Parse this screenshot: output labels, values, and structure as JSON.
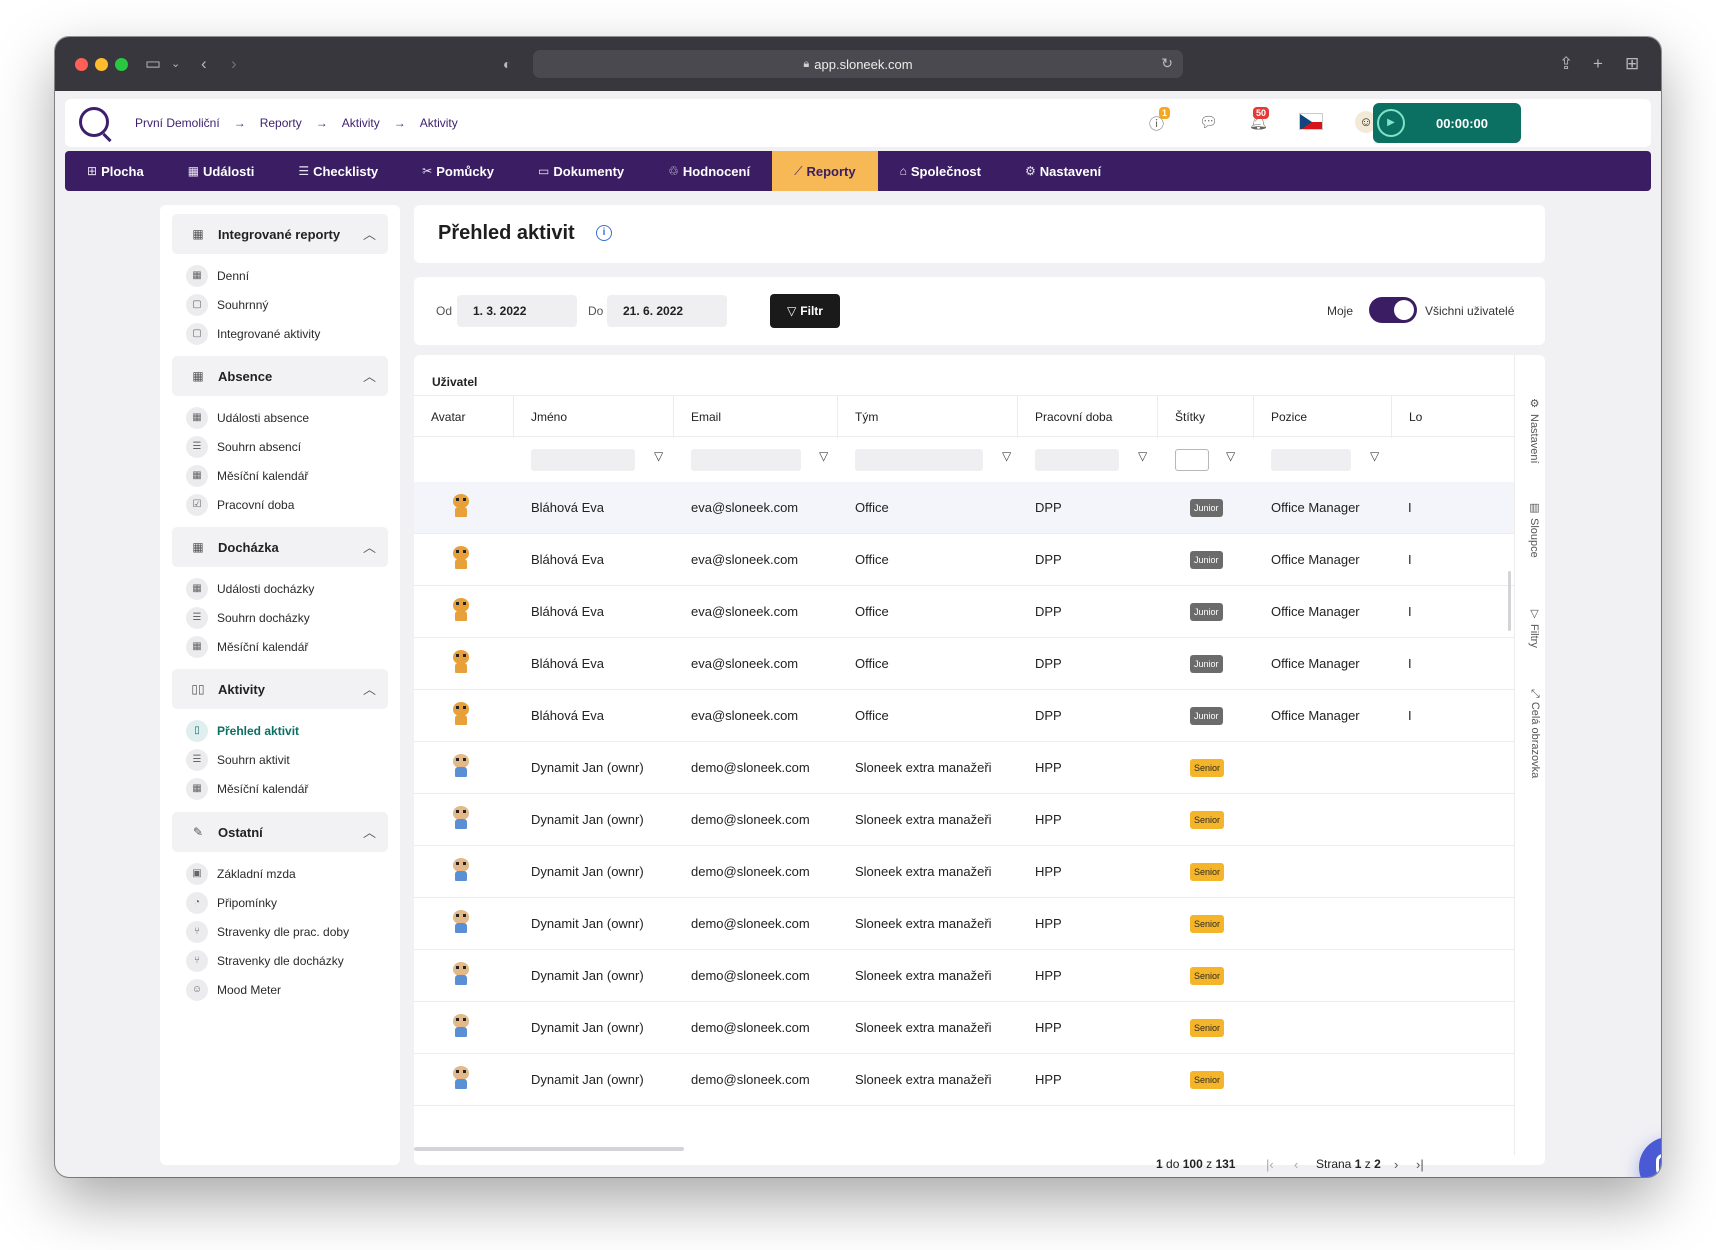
{
  "browser": {
    "url": "app.sloneek.com"
  },
  "breadcrumb": [
    "První Demoliční",
    "Reporty",
    "Aktivity",
    "Aktivity"
  ],
  "header": {
    "info_badge": "1",
    "notif_badge": "50",
    "timer": "00:00:00"
  },
  "nav": [
    {
      "label": "Plocha",
      "icon": "grid-icon"
    },
    {
      "label": "Události",
      "icon": "calendar-icon"
    },
    {
      "label": "Checklisty",
      "icon": "checklist-icon"
    },
    {
      "label": "Pomůcky",
      "icon": "tools-icon"
    },
    {
      "label": "Dokumenty",
      "icon": "folder-icon"
    },
    {
      "label": "Hodnocení",
      "icon": "feedback-icon"
    },
    {
      "label": "Reporty",
      "icon": "chart-icon",
      "active": true
    },
    {
      "label": "Společnost",
      "icon": "building-icon"
    },
    {
      "label": "Nastavení",
      "icon": "gear-icon"
    }
  ],
  "sidebar": {
    "groups": [
      {
        "title": "Integrované reporty",
        "items": [
          "Denní",
          "Souhrnný",
          "Integrované aktivity"
        ]
      },
      {
        "title": "Absence",
        "items": [
          "Události absence",
          "Souhrn absencí",
          "Měsíční kalendář",
          "Pracovní doba"
        ]
      },
      {
        "title": "Docházka",
        "items": [
          "Události docházky",
          "Souhrn docházky",
          "Měsíční kalendář"
        ]
      },
      {
        "title": "Aktivity",
        "items": [
          "Přehled aktivit",
          "Souhrn aktivit",
          "Měsíční kalendář"
        ],
        "active_item": "Přehled aktivit"
      },
      {
        "title": "Ostatní",
        "items": [
          "Základní mzda",
          "Připomínky",
          "Stravenky dle prac. doby",
          "Stravenky dle docházky",
          "Mood Meter"
        ]
      }
    ]
  },
  "page": {
    "title": "Přehled aktivit"
  },
  "filter": {
    "from_label": "Od",
    "from_value": "1. 3. 2022",
    "to_label": "Do",
    "to_value": "21. 6. 2022",
    "button": "Filtr",
    "toggle_left": "Moje",
    "toggle_right": "Všichni uživatelé",
    "toggle_state": "Všichni uživatelé"
  },
  "table": {
    "group_label": "Uživatel",
    "columns": [
      "Avatar",
      "Jméno",
      "Email",
      "Tým",
      "Pracovní doba",
      "Štítky",
      "Pozice",
      "Lo"
    ],
    "rows": [
      {
        "name": "Bláhová Eva",
        "email": "eva@sloneek.com",
        "team": "Office",
        "work": "DPP",
        "tag": "Junior",
        "position": "Office Manager",
        "extra": "I"
      },
      {
        "name": "Bláhová Eva",
        "email": "eva@sloneek.com",
        "team": "Office",
        "work": "DPP",
        "tag": "Junior",
        "position": "Office Manager",
        "extra": "I"
      },
      {
        "name": "Bláhová Eva",
        "email": "eva@sloneek.com",
        "team": "Office",
        "work": "DPP",
        "tag": "Junior",
        "position": "Office Manager",
        "extra": "I"
      },
      {
        "name": "Bláhová Eva",
        "email": "eva@sloneek.com",
        "team": "Office",
        "work": "DPP",
        "tag": "Junior",
        "position": "Office Manager",
        "extra": "I"
      },
      {
        "name": "Bláhová Eva",
        "email": "eva@sloneek.com",
        "team": "Office",
        "work": "DPP",
        "tag": "Junior",
        "position": "Office Manager",
        "extra": "I"
      },
      {
        "name": "Dynamit Jan (ownr)",
        "email": "demo@sloneek.com",
        "team": "Sloneek extra manažeři",
        "work": "HPP",
        "tag": "Senior",
        "position": "",
        "extra": ""
      },
      {
        "name": "Dynamit Jan (ownr)",
        "email": "demo@sloneek.com",
        "team": "Sloneek extra manažeři",
        "work": "HPP",
        "tag": "Senior",
        "position": "",
        "extra": ""
      },
      {
        "name": "Dynamit Jan (ownr)",
        "email": "demo@sloneek.com",
        "team": "Sloneek extra manažeři",
        "work": "HPP",
        "tag": "Senior",
        "position": "",
        "extra": ""
      },
      {
        "name": "Dynamit Jan (ownr)",
        "email": "demo@sloneek.com",
        "team": "Sloneek extra manažeři",
        "work": "HPP",
        "tag": "Senior",
        "position": "",
        "extra": ""
      },
      {
        "name": "Dynamit Jan (ownr)",
        "email": "demo@sloneek.com",
        "team": "Sloneek extra manažeři",
        "work": "HPP",
        "tag": "Senior",
        "position": "",
        "extra": ""
      },
      {
        "name": "Dynamit Jan (ownr)",
        "email": "demo@sloneek.com",
        "team": "Sloneek extra manažeři",
        "work": "HPP",
        "tag": "Senior",
        "position": "",
        "extra": ""
      },
      {
        "name": "Dynamit Jan (ownr)",
        "email": "demo@sloneek.com",
        "team": "Sloneek extra manažeři",
        "work": "HPP",
        "tag": "Senior",
        "position": "",
        "extra": ""
      }
    ],
    "side_tabs": [
      "Nastavení",
      "Sloupce",
      "Filtry",
      "Celá obrazovka"
    ]
  },
  "pager": {
    "from": "1",
    "to": "100",
    "total": "131",
    "word_do": "do",
    "word_z": "z",
    "page_label": "Strana",
    "page": "1",
    "pages": "2"
  },
  "colors": {
    "nav_bg": "#3a1d63",
    "nav_active": "#f7b955",
    "accent_green": "#0b6f62",
    "junior_tag": "#6b6b6b",
    "senior_tag": "#f5b52a",
    "chat_button": "#4a5ad4"
  }
}
